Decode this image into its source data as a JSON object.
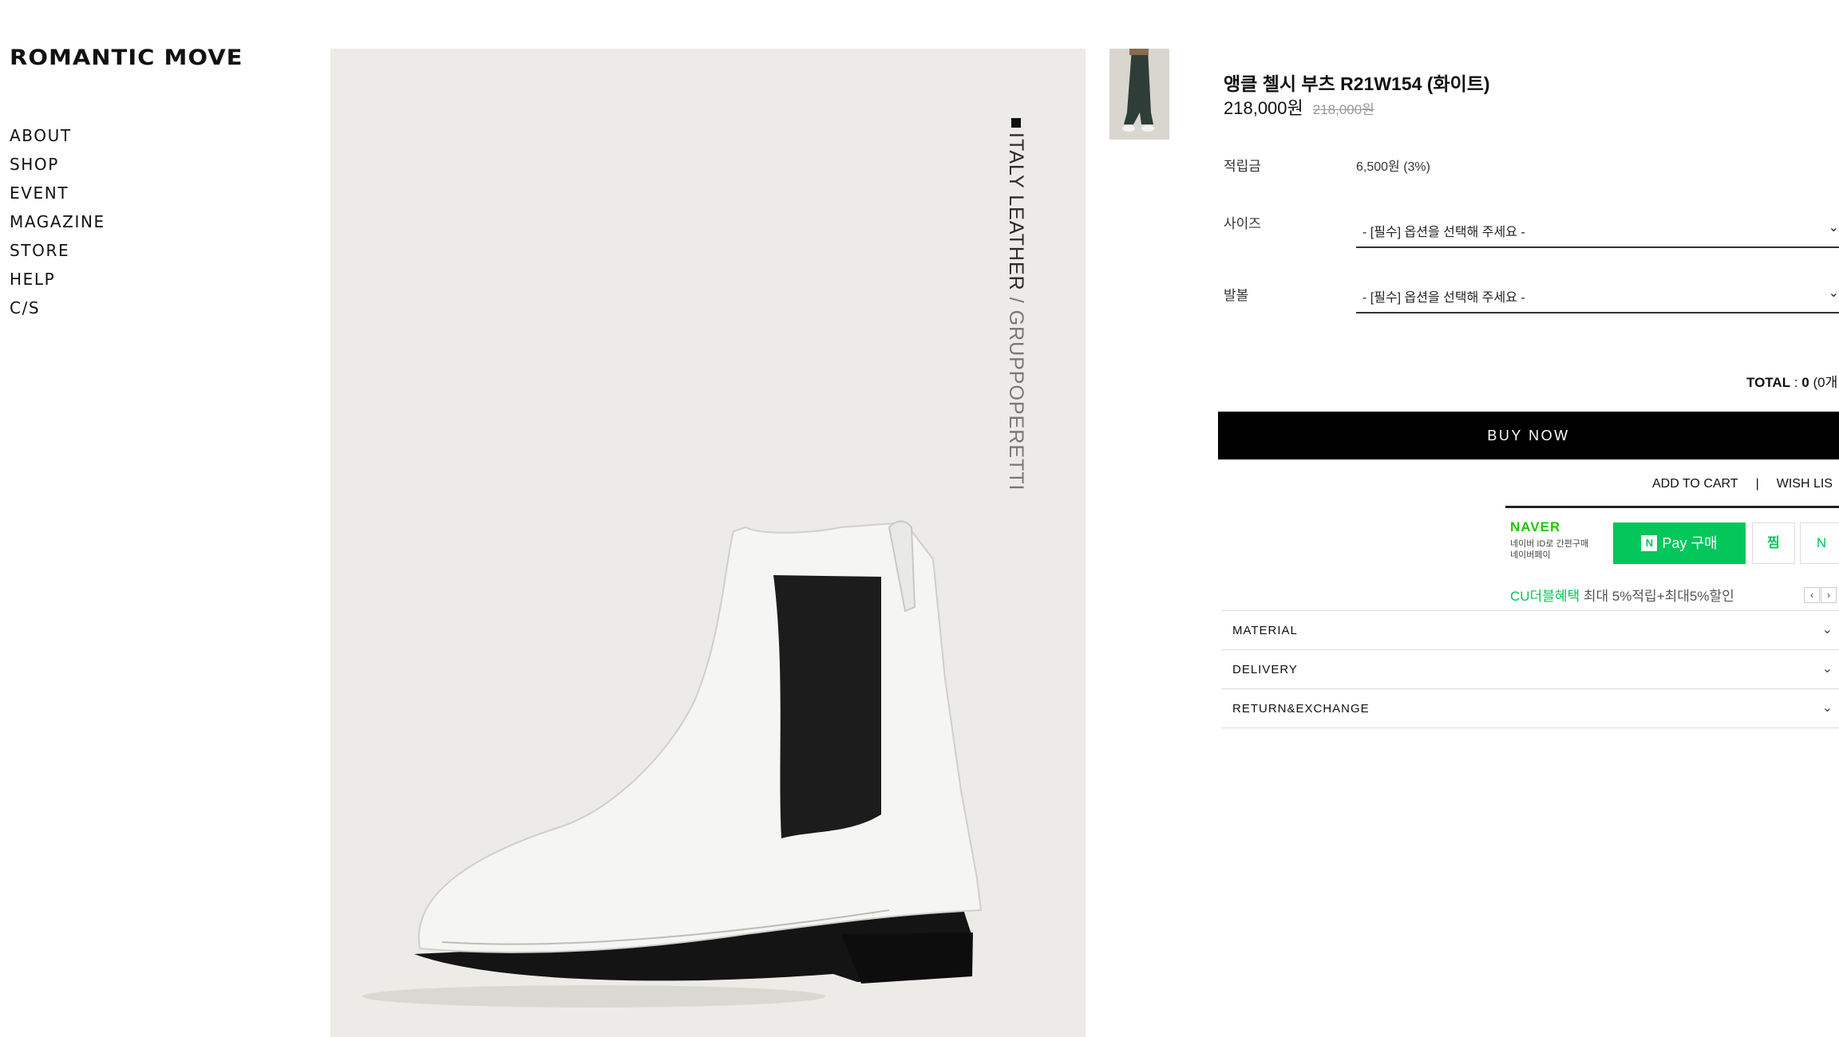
{
  "brand": {
    "logo_text": "ROMANTIC MOVE"
  },
  "nav": [
    "ABOUT",
    "SHOP",
    "EVENT",
    "MAGAZINE",
    "STORE",
    "HELP",
    "C/S"
  ],
  "hero": {
    "vertical_text_dark": "ITALY LEATHER",
    "vertical_text_sep": " / ",
    "vertical_text_light": "GRUPPOPERETTI"
  },
  "product": {
    "name": "앵클 첼시 부츠 R21W154 (화이트)",
    "price": "218,000원",
    "original_price": "218,000원",
    "points_label": "적립금",
    "points_value": "6,500원 (3%)",
    "size_label": "사이즈",
    "size_placeholder": "- [필수] 옵션을 선택해 주세요 -",
    "width_label": "발볼",
    "width_placeholder": "- [필수] 옵션을 선택해 주세요 -"
  },
  "total": {
    "label": "TOTAL",
    "sep": " : ",
    "amount": "0",
    "count": " (0개"
  },
  "actions": {
    "buy_now": "BUY NOW",
    "add_to_cart": "ADD TO CART",
    "sep": "|",
    "wish_list": "WISH LIS"
  },
  "npay": {
    "brand": "NAVER",
    "sub_line1": "네이버 ID로 간편구매",
    "sub_line2": "네이버페이",
    "pay_n": "N",
    "pay_label": "Pay 구매",
    "zzim": "찜",
    "talk": "N"
  },
  "benefit": {
    "green": "CU더블혜택",
    "rest": " 최대 5%적립+최대5%할인"
  },
  "accordion": [
    "MATERIAL",
    "DELIVERY",
    "RETURN&EXCHANGE"
  ],
  "colors": {
    "buy_bg": "#000000",
    "npay_green": "#03c75a",
    "hero_bg": "#ecebe7"
  }
}
